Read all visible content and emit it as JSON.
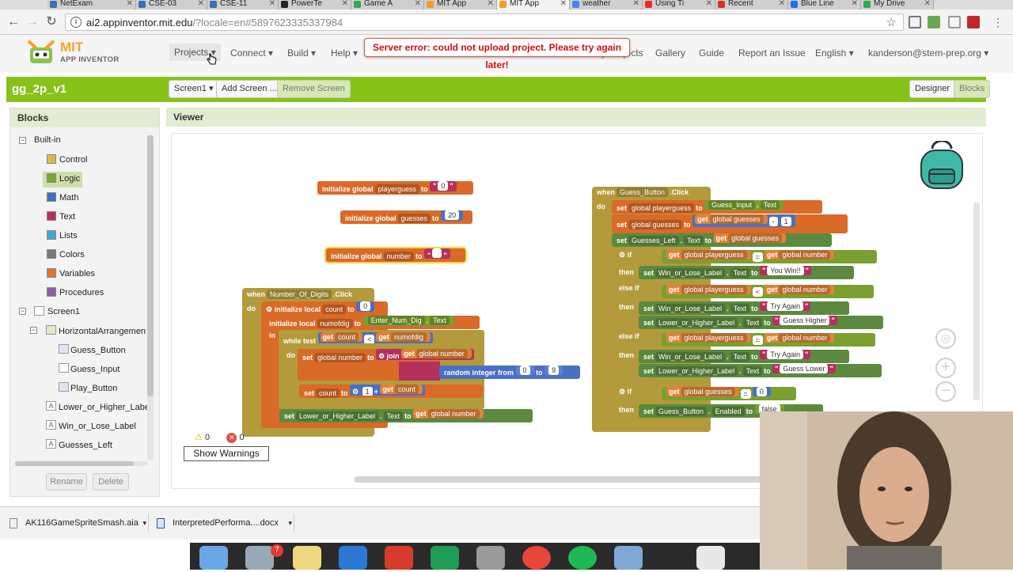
{
  "browser": {
    "tabs": [
      "NetExam",
      "CSE-03",
      "CSE-11",
      "PowerTe",
      "Game A",
      "MIT App",
      "MIT App",
      "weather",
      "Using Ti",
      "Recent",
      "Blue Line",
      "My Drive"
    ],
    "url_host": "ai2.appinventor.mit.edu",
    "url_rest": "/?locale=en#5897623335337984"
  },
  "app": {
    "brand_top": "MIT",
    "brand_bottom": "APP INVENTOR",
    "menus": {
      "projects": "Projects",
      "connect": "Connect",
      "build": "Build",
      "help": "Help",
      "my_projects": "My Projects",
      "gallery": "Gallery",
      "guide": "Guide",
      "report": "Report an Issue",
      "language": "English",
      "user": "kanderson@stem-prep.org"
    },
    "error": "Server error: could not upload project. Please try again later!"
  },
  "toolbar": {
    "project_name": "gg_2p_v1",
    "screen_select": "Screen1",
    "add_screen": "Add Screen ...",
    "remove_screen": "Remove Screen",
    "designer": "Designer",
    "blocks": "Blocks"
  },
  "blocks_panel": {
    "title": "Blocks",
    "builtin": "Built-in",
    "builtin_items": [
      {
        "label": "Control",
        "color": "#d6b84e"
      },
      {
        "label": "Logic",
        "color": "#7aa836"
      },
      {
        "label": "Math",
        "color": "#3f6ec4"
      },
      {
        "label": "Text",
        "color": "#b5305c"
      },
      {
        "label": "Lists",
        "color": "#41a6d4"
      },
      {
        "label": "Colors",
        "color": "#7a7a7a"
      },
      {
        "label": "Variables",
        "color": "#e0762c"
      },
      {
        "label": "Procedures",
        "color": "#8a5fa8"
      }
    ],
    "screen": "Screen1",
    "arrangement": "HorizontalArrangemen",
    "arrangement_children": [
      "Guess_Button",
      "Guess_Input",
      "Play_Button"
    ],
    "labels": [
      "Lower_or_Higher_Labe",
      "Win_or_Lose_Label",
      "Guesses_Left"
    ],
    "rename": "Rename",
    "delete": "Delete"
  },
  "viewer": {
    "title": "Viewer",
    "warnings_count": "0",
    "errors_count": "0",
    "show_warnings": "Show Warnings"
  },
  "blocks_text": {
    "g1_init": "initialize global",
    "g1_name": "playerguess",
    "g1_to": "to",
    "g1_val": "0",
    "g2_init": "initialize global",
    "g2_name": "guesses",
    "g2_to": "to",
    "g2_val": "20",
    "g3_init": "initialize global",
    "g3_name": "number",
    "g3_to": "to",
    "g3_val": "",
    "nd_when": "when",
    "nd_comp": "Number_Of_Digits",
    "nd_evt": ".Click",
    "nd_do": "do",
    "nd_local": "initialize local",
    "nd_count": "count",
    "nd_to": "to",
    "nd_zero": "0",
    "nd_local2": "initialize local",
    "nd_numofdig": "numofdig",
    "nd_to2": "to",
    "nd_input": "Enter_Num_Dig",
    "nd_text": "Text",
    "nd_in": "in",
    "nd_while": "while",
    "nd_test": "test",
    "nd_get": "get",
    "nd_getcount": "count",
    "nd_lt": "<",
    "nd_get2": "get",
    "nd_getnum": "numofdig",
    "nd_do2": "do",
    "nd_set": "set",
    "nd_gnum": "global number",
    "nd_to3": "to",
    "nd_join": "join",
    "nd_get3": "get",
    "nd_gnum2": "global number",
    "nd_rand": "random integer from",
    "nd_from": "0",
    "nd_to4": "to",
    "nd_upto": "9",
    "nd_set2": "set",
    "nd_count2": "count",
    "nd_to5": "to",
    "nd_one": "1",
    "nd_plus": "+",
    "nd_get4": "get",
    "nd_count3": "count",
    "nd_set3": "set",
    "nd_lbl": "Lower_or_Higher_Label",
    "nd_lbltext": "Text",
    "nd_to6": "to",
    "nd_get5": "get",
    "nd_gnum3": "global number",
    "gb_when": "when",
    "gb_comp": "Guess_Button",
    "gb_evt": ".Click",
    "gb_do": "do",
    "gb_set1": "set",
    "gb_pg": "global playerguess",
    "gb_to1": "to",
    "gb_input": "Guess_Input",
    "gb_text1": "Text",
    "gb_set2": "set",
    "gb_gg": "global guesses",
    "gb_to2": "to",
    "gb_get1": "get",
    "gb_gg2": "global guesses",
    "gb_minus": "-",
    "gb_one": "1",
    "gb_set3": "set",
    "gb_left": "Guesses_Left",
    "gb_text2": "Text",
    "gb_to3": "to",
    "gb_get2": "get",
    "gb_gg3": "global guesses",
    "gb_if": "if",
    "gb_get3": "get",
    "gb_pg2": "global playerguess",
    "gb_eq": "=",
    "gb_get4": "get",
    "gb_gn": "global number",
    "gb_then": "then",
    "gb_set4": "set",
    "gb_wl": "Win_or_Lose_Label",
    "gb_text3": "Text",
    "gb_to4": "to",
    "gb_win": "You Win!!",
    "gb_elseif": "else if",
    "gb_get5": "get",
    "gb_pg3": "global playerguess",
    "gb_lt": "<",
    "gb_get6": "get",
    "gb_gn2": "global number",
    "gb_then2": "then",
    "gb_set5": "set",
    "gb_wl2": "Win_or_Lose_Label",
    "gb_text4": "Text",
    "gb_to5": "to",
    "gb_try": "Try Again",
    "gb_set6": "set",
    "gb_lh": "Lower_or_Higher_Label",
    "gb_text5": "Text",
    "gb_to6": "to",
    "gb_higher": "Guess Higher",
    "gb_elseif2": "else if",
    "gb_get7": "get",
    "gb_pg4": "global playerguess",
    "gb_eq2": "=",
    "gb_get8": "get",
    "gb_gn3": "global number",
    "gb_then3": "then",
    "gb_set7": "set",
    "gb_wl3": "Win_or_Lose_Label",
    "gb_text6": "Text",
    "gb_to7": "to",
    "gb_try2": "Try Again",
    "gb_set8": "set",
    "gb_lh2": "Lower_or_Higher_Label",
    "gb_text7": "Text",
    "gb_to8": "to",
    "gb_lower": "Guess Lower",
    "gb_if2": "if",
    "gb_get9": "get",
    "gb_gg4": "global guesses",
    "gb_eq3": "=",
    "gb_zero": "0",
    "gb_then4": "then",
    "gb_set9": "set",
    "gb_btn": "Guess_Button",
    "gb_enabled": "Enabled",
    "gb_to9": "to",
    "gb_false": "false"
  },
  "downloads": [
    "AK116GameSpriteSmash.aia",
    "InterpretedPerforma....docx"
  ]
}
